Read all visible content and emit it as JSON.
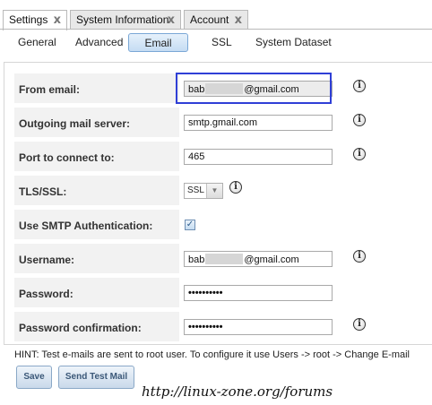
{
  "top_tabs": [
    {
      "label": "Settings",
      "active": true
    },
    {
      "label": "System Information",
      "active": false
    },
    {
      "label": "Account",
      "active": false
    }
  ],
  "close_glyph": "ⅹ",
  "sub_tabs": [
    {
      "label": "General",
      "active": false
    },
    {
      "label": "Advanced",
      "active": false
    },
    {
      "label": "Email",
      "active": true
    },
    {
      "label": "SSL",
      "active": false
    },
    {
      "label": "System Dataset",
      "active": false
    }
  ],
  "form": {
    "from_email": {
      "label": "From email:",
      "value_prefix": "bab",
      "value_suffix": "@gmail.com"
    },
    "outgoing_server": {
      "label": "Outgoing mail server:",
      "value": "smtp.gmail.com"
    },
    "port": {
      "label": "Port to connect to:",
      "value": "465"
    },
    "tls": {
      "label": "TLS/SSL:",
      "value": "SSL"
    },
    "smtp_auth": {
      "label": "Use SMTP Authentication:",
      "checked": true
    },
    "username": {
      "label": "Username:",
      "value_prefix": "bab",
      "value_suffix": "@gmail.com"
    },
    "password": {
      "label": "Password:",
      "value": "••••••••••"
    },
    "password_confirm": {
      "label": "Password confirmation:",
      "value": "••••••••••"
    }
  },
  "info_glyph": "i",
  "hint": "HINT: Test e-mails are sent to root user. To configure it use Users -> root -> Change E-mail",
  "buttons": {
    "save": "Save",
    "send_test": "Send Test Mail"
  },
  "watermark": "http://linux-zone.org/forums",
  "colors": {
    "highlight_box": "#2f3fd6",
    "active_subtab": "#c5dcf3"
  }
}
